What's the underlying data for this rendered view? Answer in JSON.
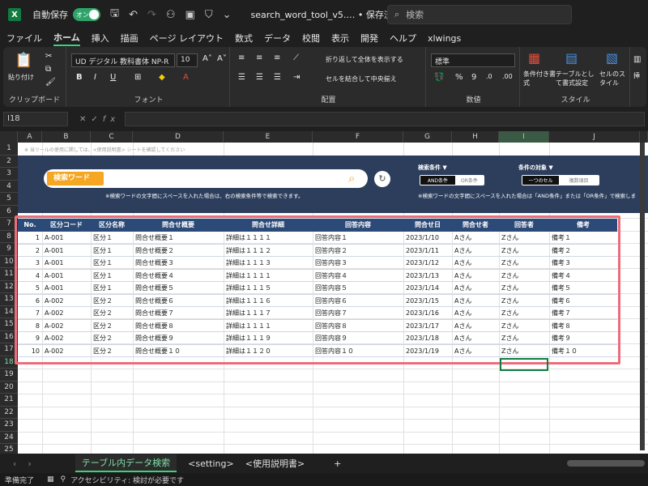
{
  "titlebar": {
    "autosave_label": "自動保存",
    "autosave_state": "オン",
    "doc_title": "search_word_tool_v5.… • 保存済み ⌄",
    "search_placeholder": "検索"
  },
  "menu": [
    "ファイル",
    "ホーム",
    "挿入",
    "描画",
    "ページ レイアウト",
    "数式",
    "データ",
    "校閲",
    "表示",
    "開発",
    "ヘルプ",
    "xlwings"
  ],
  "ribbon": {
    "clipboard": {
      "paste": "貼り付け",
      "label": "クリップボード"
    },
    "font": {
      "name": "UD デジタル 教科書体 NP-R",
      "size": "10",
      "bold": "B",
      "italic": "I",
      "underline": "U",
      "label": "フォント"
    },
    "alignment": {
      "wrap": "折り返して全体を表示する",
      "merge": "セルを結合して中央揃え",
      "label": "配置"
    },
    "number": {
      "format": "標準",
      "label": "数値"
    },
    "style": {
      "conditional": "条件付き書式",
      "table": "テーブルとして書式設定",
      "cell": "セルのスタイル",
      "label": "スタイル"
    },
    "insert_partial": "挿"
  },
  "formula": {
    "cell_ref": "I18",
    "fx": "fx"
  },
  "columns": [
    "A",
    "B",
    "C",
    "D",
    "E",
    "F",
    "G",
    "H",
    "I",
    "J"
  ],
  "rows": [
    "1",
    "2",
    "3",
    "4",
    "5",
    "6",
    "7",
    "8",
    "9",
    "10",
    "11",
    "12",
    "13",
    "14",
    "15",
    "16",
    "17",
    "18",
    "19",
    "20",
    "21",
    "22",
    "23",
    "24",
    "25"
  ],
  "sheet": {
    "note": "※ 当ツールの使用に関しては、<使用説明書> シートを確認してください",
    "keyword_label": "検索ワード",
    "keyword_hint": "※検索ワードの文字間にスペースを入れた場合は、右の検索条件等で検索できます。",
    "cond_title": "検索条件 ▼",
    "cond_and": "AND条件",
    "cond_or": "OR条件",
    "target_title": "条件の対象 ▼",
    "target_one": "一つのセル",
    "target_multi": "複数項目",
    "cond_hint": "※検索ワードの文字間にスペースを入れた場合は「AND条件」または「OR条件」で検索しま"
  },
  "table": {
    "headers": [
      "No.",
      "区分コード",
      "区分名称",
      "問合せ概要",
      "問合せ詳細",
      "回答内容",
      "問合せ日",
      "問合せ者",
      "回答者",
      "備考"
    ],
    "rows": [
      [
        "1",
        "A-001",
        "区分１",
        "問合せ概要１",
        "詳細は１１１１",
        "回答内容１",
        "2023/1/10",
        "Aさん",
        "Zさん",
        "備考１"
      ],
      [
        "2",
        "A-001",
        "区分１",
        "問合せ概要２",
        "詳細は１１１２",
        "回答内容２",
        "2023/1/11",
        "Aさん",
        "Zさん",
        "備考２"
      ],
      [
        "3",
        "A-001",
        "区分１",
        "問合せ概要３",
        "詳細は１１１３",
        "回答内容３",
        "2023/1/12",
        "Aさん",
        "Zさん",
        "備考３"
      ],
      [
        "4",
        "A-001",
        "区分１",
        "問合せ概要４",
        "詳細は１１１１",
        "回答内容４",
        "2023/1/13",
        "Aさん",
        "Zさん",
        "備考４"
      ],
      [
        "5",
        "A-001",
        "区分１",
        "問合せ概要５",
        "詳細は１１１５",
        "回答内容５",
        "2023/1/14",
        "Aさん",
        "Zさん",
        "備考５"
      ],
      [
        "6",
        "A-002",
        "区分２",
        "問合せ概要６",
        "詳細は１１１６",
        "回答内容６",
        "2023/1/15",
        "Aさん",
        "Zさん",
        "備考６"
      ],
      [
        "7",
        "A-002",
        "区分２",
        "問合せ概要７",
        "詳細は１１１７",
        "回答内容７",
        "2023/1/16",
        "Aさん",
        "Zさん",
        "備考７"
      ],
      [
        "8",
        "A-002",
        "区分２",
        "問合せ概要８",
        "詳細は１１１１",
        "回答内容８",
        "2023/1/17",
        "Aさん",
        "Zさん",
        "備考８"
      ],
      [
        "9",
        "A-002",
        "区分２",
        "問合せ概要９",
        "詳細は１１１９",
        "回答内容９",
        "2023/1/18",
        "Aさん",
        "Zさん",
        "備考９"
      ],
      [
        "10",
        "A-002",
        "区分２",
        "問合せ概要１０",
        "詳細は１１２０",
        "回答内容１０",
        "2023/1/19",
        "Aさん",
        "Zさん",
        "備考１０"
      ]
    ]
  },
  "tabs": [
    "テーブル内データ検索",
    "<setting>",
    "<使用説明書>",
    "+"
  ],
  "status": {
    "ready": "準備完了",
    "accessibility": "アクセシビリティ: 検討が必要です"
  },
  "colors": {
    "accent": "#107c41",
    "banner": "#2c3e5c",
    "header": "#2c4a78",
    "highlight": "#ec6d7a",
    "keyword": "#f5a623"
  }
}
